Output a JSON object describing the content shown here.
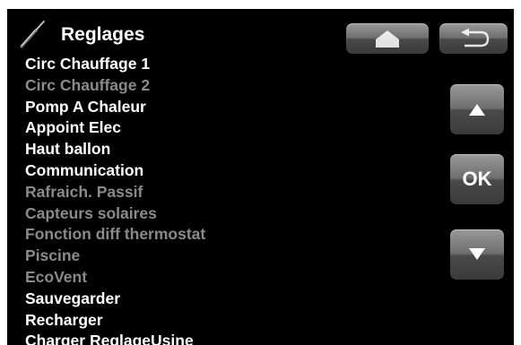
{
  "header": {
    "title": "Reglages",
    "icon": "screwdriver-icon"
  },
  "menu": {
    "items": [
      {
        "label": "Circ Chauffage 1",
        "enabled": true
      },
      {
        "label": "Circ Chauffage 2",
        "enabled": false
      },
      {
        "label": "Pomp A Chaleur",
        "enabled": true
      },
      {
        "label": "Appoint Elec",
        "enabled": true
      },
      {
        "label": "Haut ballon",
        "enabled": true
      },
      {
        "label": "Communication",
        "enabled": true
      },
      {
        "label": "Rafraich. Passif",
        "enabled": false
      },
      {
        "label": "Capteurs solaires",
        "enabled": false
      },
      {
        "label": "Fonction diff thermostat",
        "enabled": false
      },
      {
        "label": "Piscine",
        "enabled": false
      },
      {
        "label": "EcoVent",
        "enabled": false
      },
      {
        "label": "Sauvegarder",
        "enabled": true
      },
      {
        "label": "Recharger",
        "enabled": true
      },
      {
        "label": "Charger ReglageUsine",
        "enabled": true
      }
    ]
  },
  "buttons": {
    "home": {
      "icon": "home-icon"
    },
    "back": {
      "icon": "back-arrow-icon"
    },
    "up": {
      "icon": "up-arrow-icon"
    },
    "ok": {
      "label": "OK"
    },
    "down": {
      "icon": "down-arrow-icon"
    }
  },
  "colors": {
    "screen_background": "#000000",
    "text_enabled": "#ffffff",
    "text_disabled": "#8a8a8a"
  }
}
